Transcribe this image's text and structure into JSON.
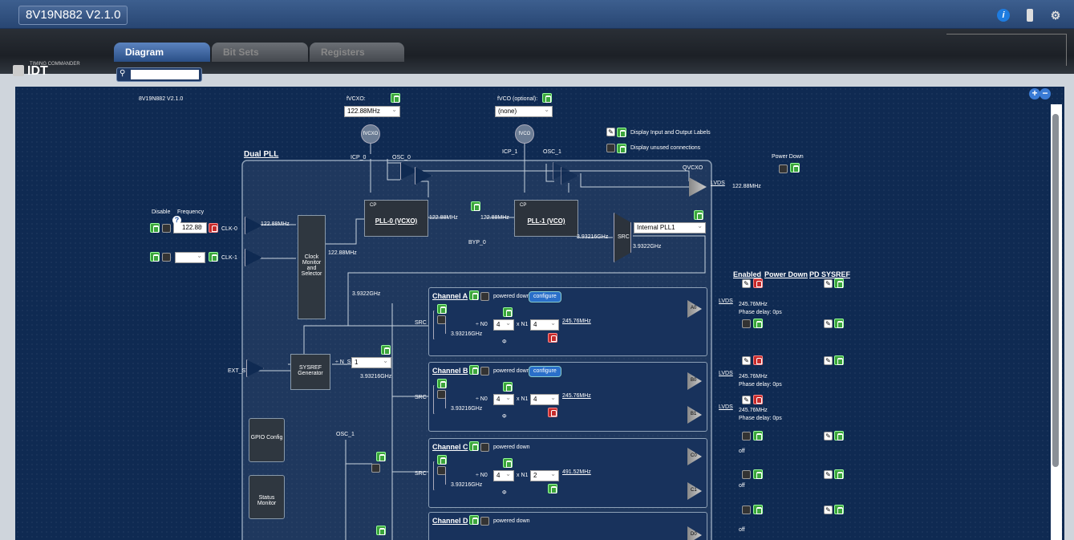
{
  "window": {
    "title": "8V19N882 V2.1.0"
  },
  "brand": {
    "logo": "IDT",
    "subtitle": "TIMING COMMANDER"
  },
  "tabs": [
    {
      "label": "Diagram"
    },
    {
      "label": "Bit Sets"
    },
    {
      "label": "Registers"
    }
  ],
  "search": {
    "value": ""
  },
  "diagram": {
    "device_label": "8V19N882 V2.1.0",
    "fvcxo_label": "fVCXO:",
    "fvcxo_value": "122.88MHz",
    "fvco_label": "fVCO (optional):",
    "fvco_value": "(none)",
    "display_labels": "Display Input and Output Labels",
    "display_unused": "Display unused connections",
    "dual_pll": "Dual PLL",
    "power_down": "Power Down",
    "qvcxo": "QVCXO",
    "lvds": "LVDS",
    "qvcxo_freq": "122.88MHz",
    "icp0": "ICP_0",
    "osc0": "OSC_0",
    "icp1": "ICP_1",
    "osc1": "OSC_1",
    "fvcxo_circle": "fVCXO",
    "fvco_circle": "fVCO",
    "disable": "Disable",
    "frequency": "Frequency",
    "clk0": "CLK-0",
    "clk1": "CLK-1",
    "clk0_value": "122.88",
    "clk0_freq": "122.88MHz",
    "clock_monitor": "Clock Monitor and Selector",
    "cms_out": "122.88MHz",
    "cp": "CP",
    "pll0": "PLL-0 (VCXO)",
    "pll1": "PLL-1 (VCO)",
    "pll0_out": "122.88MHz",
    "pll1_in": "122.88MHz",
    "byp0": "BYP_0",
    "pll1_out": "3.93216GHz",
    "src": "SRC",
    "src_select": "Internal PLL1",
    "src_out": "3.9322GHz",
    "bus": "3.9322GHz",
    "enabled": "Enabled",
    "power_down_col": "Power Down",
    "pd_sysref": "PD SYSREF",
    "ext_sys": "EXT_SYS",
    "sysref": "SYSREF Generator",
    "ns": "÷ N_S",
    "ns_value": "1",
    "sysref_freq": "3.93216GHz",
    "gpio": "GPIO Config",
    "status_monitor": "Status Monitor",
    "osc1_label": "OSC_1",
    "channels": [
      {
        "name": "Channel A",
        "state": "powered down",
        "configure": "configure",
        "src": "SRC",
        "in": "3.93216GHz",
        "n0": "÷ N0",
        "n0v": "4",
        "n1": "x N1",
        "n1v": "4",
        "out": "245.76MHz",
        "phi": "Φ"
      },
      {
        "name": "Channel B",
        "state": "powered down",
        "configure": "configure",
        "src": "SRC",
        "in": "3.93216GHz",
        "n0": "÷ N0",
        "n0v": "4",
        "n1": "x N1",
        "n1v": "4",
        "out": "245.76MHz",
        "phi": "Φ"
      },
      {
        "name": "Channel C",
        "state": "powered down",
        "src": "SRC",
        "in": "3.93216GHz",
        "n0": "÷ N0",
        "n0v": "4",
        "n1": "x N1",
        "n1v": "2",
        "out": "491.52MHz",
        "phi": "Φ"
      },
      {
        "name": "Channel D",
        "state": "powered down"
      }
    ],
    "outputs": [
      {
        "id": "A0",
        "type": "LVDS",
        "freq": "245.76MHz",
        "delay": "Phase delay: 0ps"
      },
      {
        "id": "B0",
        "type": "LVDS",
        "freq": "245.76MHz",
        "delay": "Phase delay: 0ps"
      },
      {
        "id": "B1",
        "type": "LVDS",
        "freq": "245.76MHz",
        "delay": "Phase delay: 0ps"
      },
      {
        "id": "C0",
        "state": "off"
      },
      {
        "id": "C1",
        "state": "off"
      },
      {
        "id": "D0",
        "state": "off"
      }
    ]
  }
}
